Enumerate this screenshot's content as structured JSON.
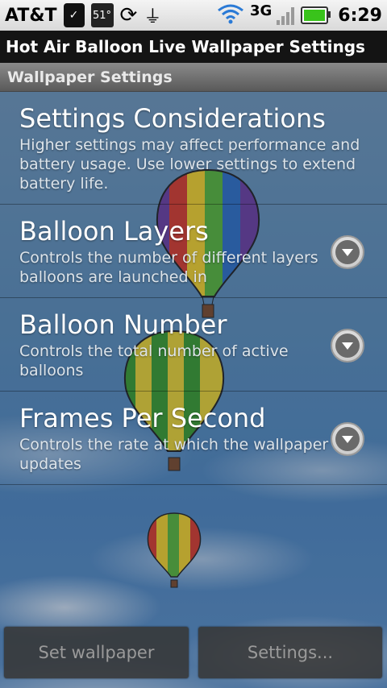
{
  "status_bar": {
    "carrier": "AT&T",
    "temperature": "51°",
    "network": "3G",
    "time": "6:29",
    "icons": [
      "shopping-bag-icon",
      "weather-icon",
      "sync-icon",
      "usb-icon",
      "wifi-icon",
      "signal-icon",
      "battery-icon"
    ],
    "battery_color": "#39c31b"
  },
  "title_bar": {
    "title": "Hot Air Balloon Live Wallpaper Settings"
  },
  "section": {
    "header": "Wallpaper Settings"
  },
  "settings": [
    {
      "title": "Settings Considerations",
      "summary": "Higher settings may affect performance and battery usage. Use lower settings to extend battery life."
    },
    {
      "title": "Balloon Layers",
      "summary": "Controls the number of different layers balloons are launched in",
      "control": "chevron-down-icon"
    },
    {
      "title": "Balloon Number",
      "summary": "Controls the total number of active balloons",
      "control": "chevron-down-icon"
    },
    {
      "title": "Frames Per Second",
      "summary": "Controls the rate at which the wallpaper updates",
      "control": "chevron-down-icon"
    }
  ],
  "buttons": {
    "set_wallpaper": "Set wallpaper",
    "settings": "Settings..."
  }
}
